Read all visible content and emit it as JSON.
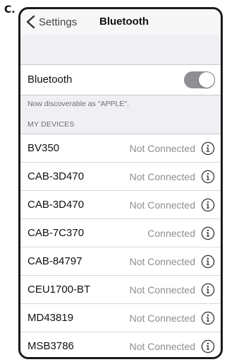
{
  "figure_label": "C.",
  "nav": {
    "back_label": "Settings",
    "title": "Bluetooth"
  },
  "bluetooth": {
    "label": "Bluetooth",
    "enabled": true,
    "discoverable_text": "Now discoverable as \"APPLE\"."
  },
  "devices_header": "MY DEVICES",
  "devices": [
    {
      "name": "BV350",
      "status": "Not Connected"
    },
    {
      "name": "CAB-3D470",
      "status": "Not Connected"
    },
    {
      "name": "CAB-3D470",
      "status": "Not Connected"
    },
    {
      "name": "CAB-7C370",
      "status": "Connected"
    },
    {
      "name": "CAB-84797",
      "status": "Not Connected"
    },
    {
      "name": "CEU1700-BT",
      "status": "Not Connected"
    },
    {
      "name": "MD43819",
      "status": "Not Connected"
    },
    {
      "name": "MSB3786",
      "status": "Not Connected"
    }
  ],
  "colors": {
    "background": "#efeff4",
    "toggle_on": "#8e8e93",
    "status_text": "#8e8e93"
  },
  "icons": {
    "back": "chevron-left-icon",
    "info": "info-icon"
  }
}
